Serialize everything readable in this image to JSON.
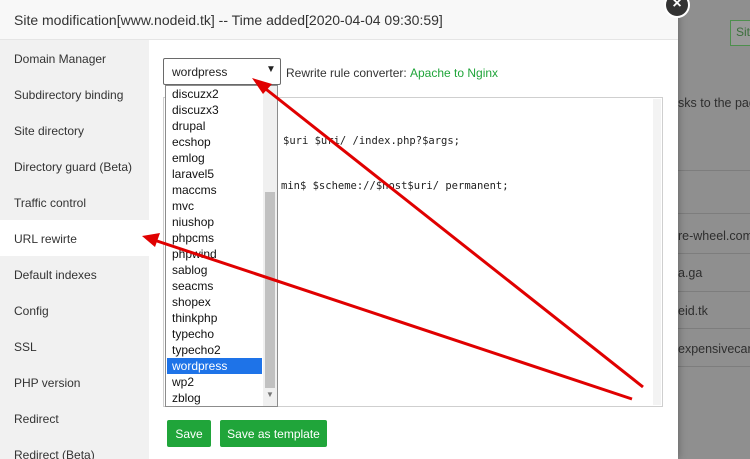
{
  "modal": {
    "title": "Site modification[www.nodeid.tk] -- Time added[2020-04-04 09:30:59]",
    "close_glyph": "×"
  },
  "sidebar": {
    "items": [
      {
        "label": "Domain Manager"
      },
      {
        "label": "Subdirectory binding"
      },
      {
        "label": "Site directory"
      },
      {
        "label": "Directory guard (Beta)"
      },
      {
        "label": "Traffic control"
      },
      {
        "label": "URL rewirte"
      },
      {
        "label": "Default indexes"
      },
      {
        "label": "Config"
      },
      {
        "label": "SSL"
      },
      {
        "label": "PHP version"
      },
      {
        "label": "Redirect"
      },
      {
        "label": "Redirect (Beta)"
      }
    ],
    "active_index": 5
  },
  "rewrite": {
    "selected": "wordpress",
    "converter_label": "Rewrite rule converter:",
    "converter_link": "Apache to Nginx",
    "options": [
      "discuzx2",
      "discuzx3",
      "drupal",
      "ecshop",
      "emlog",
      "laravel5",
      "maccms",
      "mvc",
      "niushop",
      "phpcms",
      "phpwind",
      "sablog",
      "seacms",
      "shopex",
      "thinkphp",
      "typecho",
      "typecho2",
      "wordpress",
      "wp2",
      "zblog"
    ],
    "code_lines": [
      "$uri $uri/ /index.php?$args;",
      "min$ $scheme://$host$uri/ permanent;"
    ]
  },
  "buttons": {
    "save": "Save",
    "save_template": "Save as template"
  },
  "background": {
    "button_text": "Sit",
    "texts": [
      "sks to the page",
      "re-wheel.com",
      "a.ga",
      "eid.tk",
      "expensivecar.c"
    ]
  },
  "colors": {
    "accent": "#20a53a",
    "selection": "#1e73e8",
    "annotation": "#e00000"
  },
  "icons": {
    "close": "close-icon",
    "caret": "chevron-down-icon"
  }
}
